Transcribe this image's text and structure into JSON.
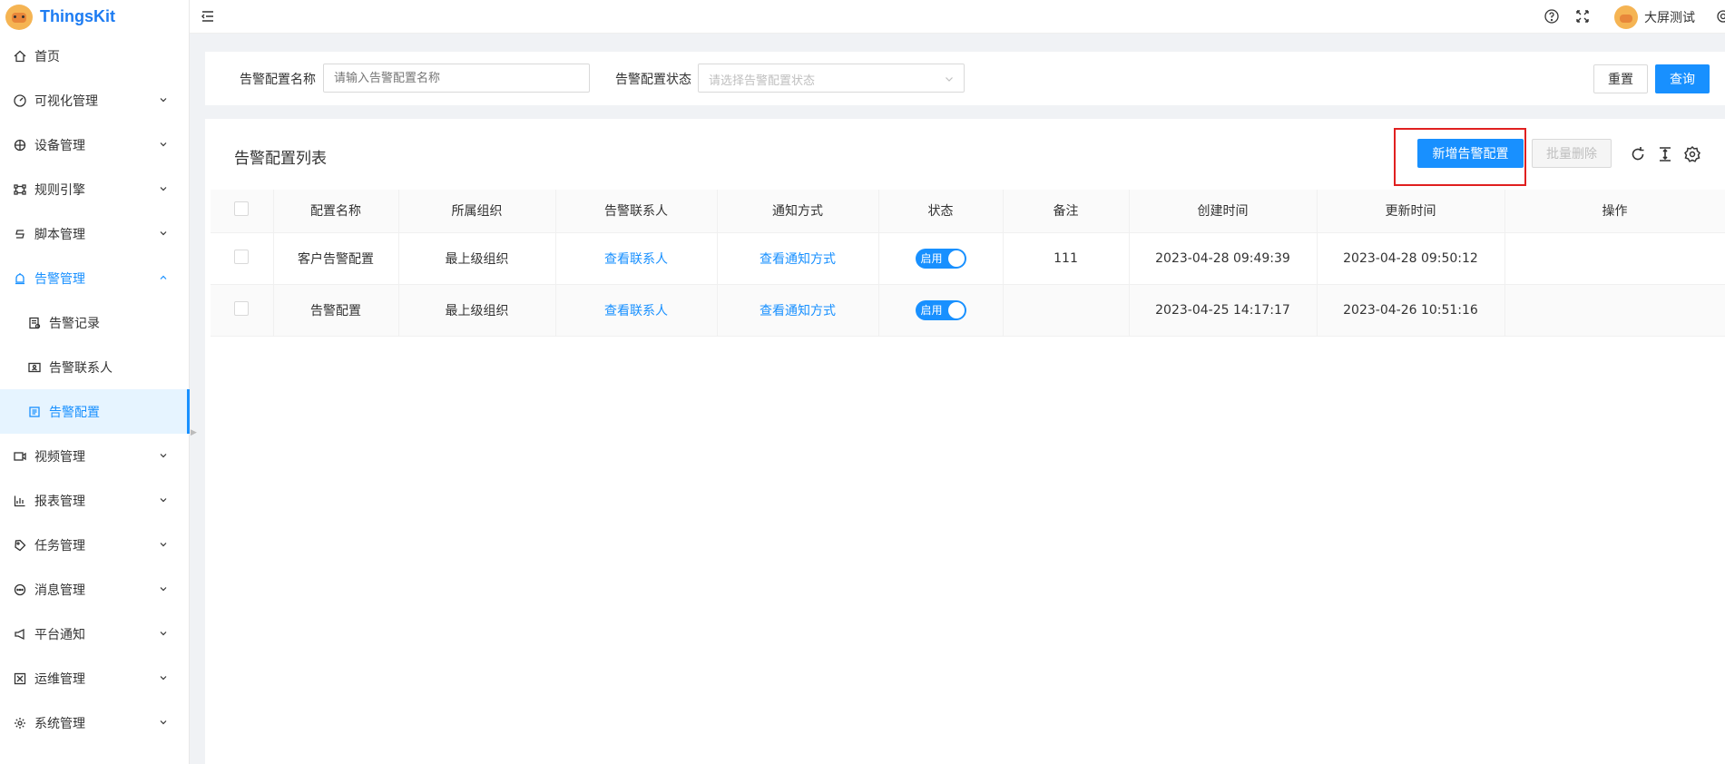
{
  "app": {
    "name": "ThingsKit"
  },
  "header": {
    "username": "大屏测试"
  },
  "sidebar": {
    "items": [
      {
        "label": "首页",
        "icon": "home-icon"
      },
      {
        "label": "可视化管理",
        "icon": "dashboard-icon"
      },
      {
        "label": "设备管理",
        "icon": "device-icon"
      },
      {
        "label": "规则引擎",
        "icon": "rule-engine-icon"
      },
      {
        "label": "脚本管理",
        "icon": "script-icon"
      },
      {
        "label": "告警管理",
        "icon": "alarm-icon"
      },
      {
        "label": "告警记录",
        "icon": "alarm-record-icon"
      },
      {
        "label": "告警联系人",
        "icon": "contact-icon"
      },
      {
        "label": "告警配置",
        "icon": "config-icon"
      },
      {
        "label": "视频管理",
        "icon": "video-icon"
      },
      {
        "label": "报表管理",
        "icon": "report-icon"
      },
      {
        "label": "任务管理",
        "icon": "task-icon"
      },
      {
        "label": "消息管理",
        "icon": "message-icon"
      },
      {
        "label": "平台通知",
        "icon": "notification-icon"
      },
      {
        "label": "运维管理",
        "icon": "ops-icon"
      },
      {
        "label": "系统管理",
        "icon": "system-icon"
      }
    ]
  },
  "search": {
    "name_label": "告警配置名称",
    "name_placeholder": "请输入告警配置名称",
    "status_label": "告警配置状态",
    "status_placeholder": "请选择告警配置状态",
    "reset_label": "重置",
    "query_label": "查询"
  },
  "panel": {
    "title": "告警配置列表",
    "add_label": "新增告警配置",
    "batch_delete_label": "批量删除"
  },
  "table": {
    "columns": [
      "配置名称",
      "所属组织",
      "告警联系人",
      "通知方式",
      "状态",
      "备注",
      "创建时间",
      "更新时间",
      "操作"
    ],
    "rows": [
      {
        "name": "客户告警配置",
        "org": "最上级组织",
        "contact": "查看联系人",
        "notify": "查看通知方式",
        "status": "启用",
        "remark": "111",
        "created": "2023-04-28 09:49:39",
        "updated": "2023-04-28 09:50:12"
      },
      {
        "name": "告警配置",
        "org": "最上级组织",
        "contact": "查看联系人",
        "notify": "查看通知方式",
        "status": "启用",
        "remark": "",
        "created": "2023-04-25 14:17:17",
        "updated": "2023-04-26 10:51:16"
      }
    ]
  },
  "colors": {
    "primary": "#1890ff",
    "highlight": "#e02020"
  }
}
